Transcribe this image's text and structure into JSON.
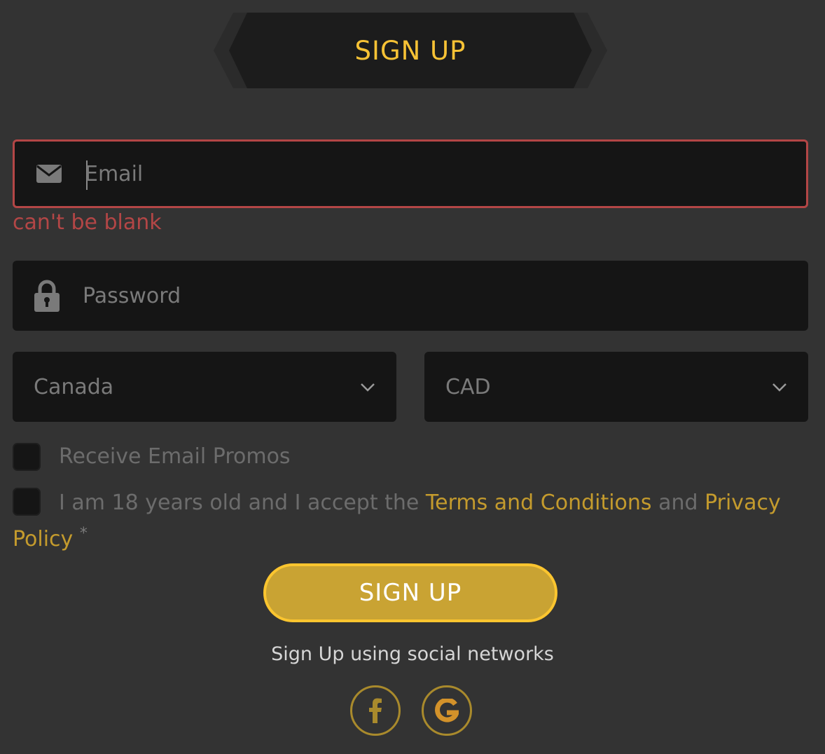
{
  "header": {
    "title": "SIGN UP"
  },
  "email": {
    "placeholder": "Email",
    "value": "",
    "icon": "envelope-icon",
    "error": "can't be blank",
    "error_color": "#b34646"
  },
  "password": {
    "placeholder": "Password",
    "value": "",
    "icon": "lock-icon"
  },
  "country": {
    "selected": "Canada"
  },
  "currency": {
    "selected": "CAD"
  },
  "promos": {
    "label": "Receive Email Promos",
    "checked": false
  },
  "terms": {
    "checked": false,
    "prefix": "I am 18 years old and I accept the ",
    "terms_link": "Terms and Conditions",
    "middle": " and ",
    "privacy_link": "Privacy Policy",
    "required_mark": "*"
  },
  "submit": {
    "label": "SIGN UP"
  },
  "social": {
    "label": "Sign Up using social networks",
    "providers": [
      {
        "name": "facebook",
        "icon": "facebook-icon"
      },
      {
        "name": "google",
        "icon": "google-icon"
      }
    ]
  },
  "colors": {
    "accent": "#f7c235",
    "button": "#c9a333",
    "link": "#c49b2d",
    "background": "#333333",
    "field": "#151515"
  }
}
